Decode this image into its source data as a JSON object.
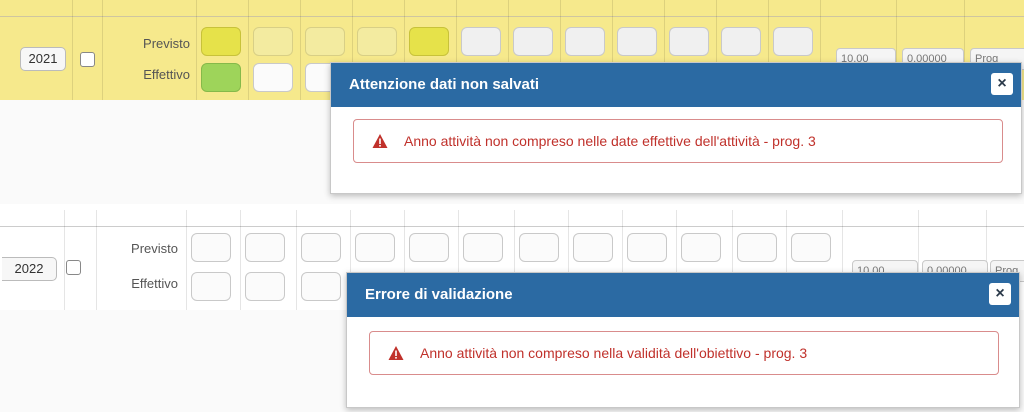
{
  "screen1": {
    "row": {
      "year": "2021",
      "planned_label": "Previsto",
      "actual_label": "Effettivo",
      "value1": "10,00",
      "value2": "0,00000",
      "extra_button": "Prog"
    },
    "dialog": {
      "title": "Attenzione dati non salvati",
      "close": "×",
      "message": "Anno attività non compreso nelle date effettive dell'attività - prog. 3"
    }
  },
  "screen2": {
    "row": {
      "year": "2022",
      "planned_label": "Previsto",
      "actual_label": "Effettivo",
      "value1": "10,00",
      "value2": "0,00000",
      "extra_button": "Prog"
    },
    "dialog": {
      "title": "Errore di validazione",
      "close": "×",
      "message": "Anno attività non compreso nella validità dell'obiettivo - prog. 3"
    }
  },
  "colors": {
    "dialog_header": "#2b6aa3",
    "error_text": "#c0312b",
    "planned_yellow": "#e6e24a",
    "actual_green": "#9ed45a"
  },
  "icons": {
    "alert": "warning-triangle-icon",
    "close": "close-icon"
  }
}
